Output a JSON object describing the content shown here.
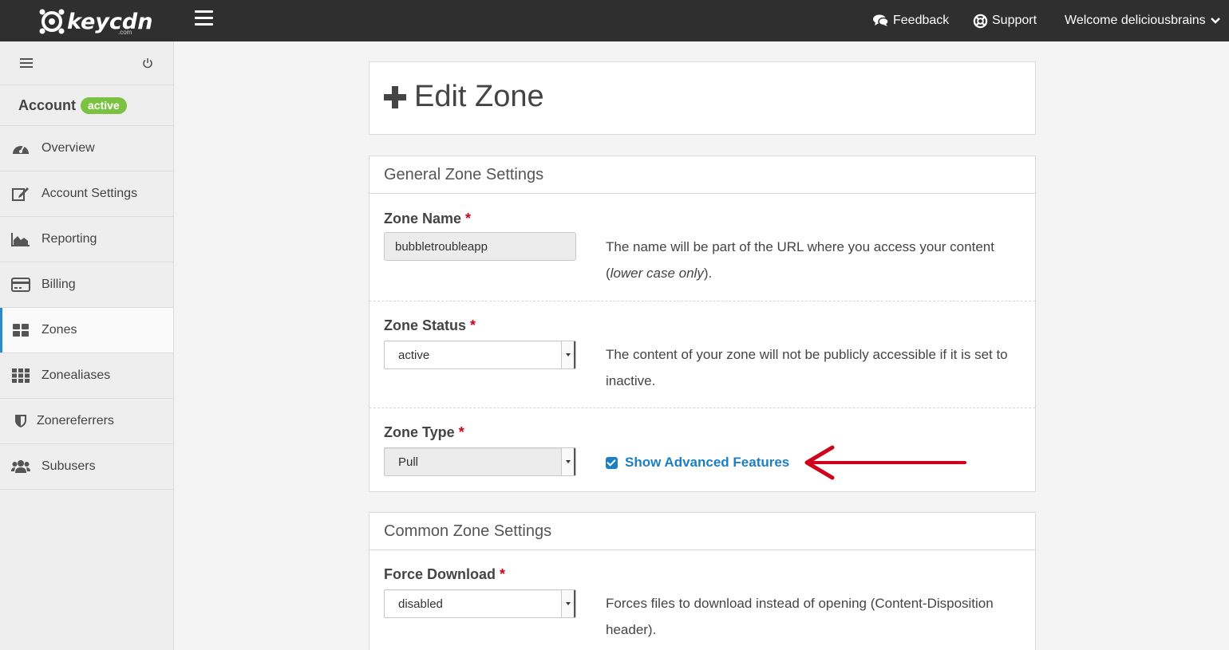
{
  "header": {
    "logo_text": "keycdn",
    "logo_sub": ".com",
    "feedback": "Feedback",
    "support": "Support",
    "welcome": "Welcome deliciousbrains"
  },
  "sidebar": {
    "account_label": "Account",
    "account_badge": "active",
    "items": [
      {
        "label": "Overview",
        "icon": "dashboard-icon"
      },
      {
        "label": "Account Settings",
        "icon": "edit-icon"
      },
      {
        "label": "Reporting",
        "icon": "area-chart-icon"
      },
      {
        "label": "Billing",
        "icon": "credit-card-icon"
      },
      {
        "label": "Zones",
        "icon": "grid-icon",
        "active": true
      },
      {
        "label": "Zonealiases",
        "icon": "grid-nine-icon"
      },
      {
        "label": "Zonereferrers",
        "icon": "shield-icon"
      },
      {
        "label": "Subusers",
        "icon": "users-icon"
      }
    ]
  },
  "page": {
    "title": "Edit Zone"
  },
  "general": {
    "heading": "General Zone Settings",
    "zone_name": {
      "label": "Zone Name",
      "required": "*",
      "value": "bubbletroubleapp",
      "help_main": "The name will be part of the URL where you access your content (",
      "help_em": "lower case only",
      "help_end": ")."
    },
    "zone_status": {
      "label": "Zone Status",
      "required": "*",
      "value": "active",
      "help": "The content of your zone will not be publicly accessible if it is set to inactive."
    },
    "zone_type": {
      "label": "Zone Type",
      "required": "*",
      "value": "Pull",
      "advanced_label": "Show Advanced Features",
      "advanced_checked": true
    }
  },
  "common": {
    "heading": "Common Zone Settings",
    "force_download": {
      "label": "Force Download",
      "required": "*",
      "value": "disabled",
      "help": "Forces files to download instead of opening (Content-Disposition header)."
    }
  },
  "colors": {
    "topbar": "#2f2f2f",
    "accent": "#1c7fc4",
    "badge": "#7cc242",
    "required": "#d0021b",
    "annotation_arrow": "#d0021b"
  }
}
